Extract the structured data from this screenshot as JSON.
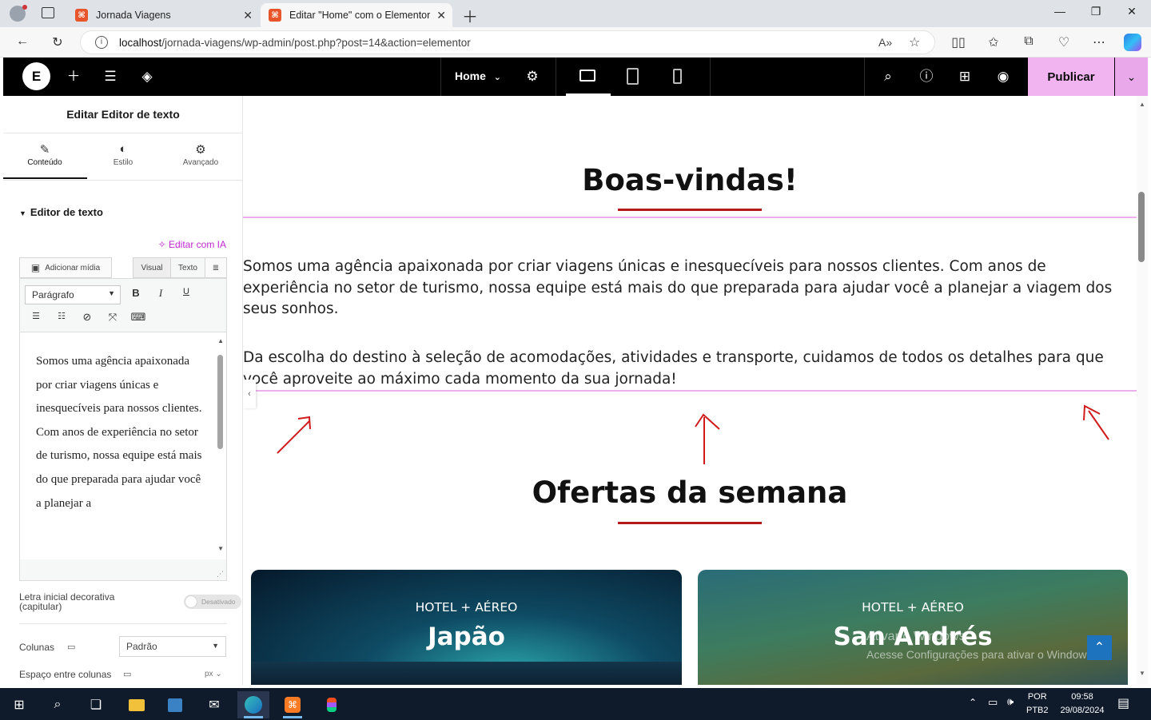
{
  "browser": {
    "tabs": [
      {
        "title": "Jornada Viagens",
        "active": false
      },
      {
        "title": "Editar \"Home\" com o Elementor",
        "active": true
      }
    ],
    "url_host": "localhost",
    "url_path": "/jornada-viagens/wp-admin/post.php?post=14&action=elementor"
  },
  "elementor_bar": {
    "page_name": "Home",
    "publish_label": "Publicar",
    "device_modes": [
      "desktop-icon",
      "tablet-icon",
      "mobile-icon"
    ]
  },
  "panel": {
    "title": "Editar Editor de texto",
    "tabs": [
      {
        "label": "Conteúdo",
        "icon": "pencil-icon"
      },
      {
        "label": "Estilo",
        "icon": "half-circle-icon"
      },
      {
        "label": "Avançado",
        "icon": "gear-icon"
      }
    ],
    "section_title": "Editor de texto",
    "ai_link": "Editar com IA",
    "add_media": "Adicionar mídia",
    "visual_tab": "Visual",
    "text_tab": "Texto",
    "paragraph_select": "Parágrafo",
    "editor_text": "Somos uma agência apaixonada por criar viagens únicas e inesquecíveis para nossos clientes. Com anos de experiência no setor de turismo, nossa equipe está mais do que preparada para ajudar você a planejar a",
    "drop_cap_label": "Letra inicial decorativa (capitular)",
    "drop_cap_value": "Desativado",
    "columns_label": "Colunas",
    "columns_value": "Padrão",
    "column_gap_label": "Espaço entre colunas",
    "column_gap_unit": "px"
  },
  "canvas": {
    "heading1": "Boas-vindas!",
    "paragraph1": "Somos uma agência apaixonada por criar viagens únicas e inesquecíveis para nossos clientes. Com anos de experiência no setor de turismo, nossa equipe está mais do que preparada para ajudar você a planejar a viagem dos seus sonhos.",
    "paragraph2": "Da escolha do destino à seleção de acomodações, atividades e transporte, cuidamos de todos os detalhes para que você aproveite ao máximo cada momento da sua jornada!",
    "heading2": "Ofertas da semana",
    "cards": [
      {
        "subtitle": "HOTEL + AÉREO",
        "title": "Japão"
      },
      {
        "subtitle": "HOTEL + AÉREO",
        "title": "San Andrés"
      }
    ],
    "watermark_line1": "Ativar o Windows",
    "watermark_line2": "Acesse Configurações para ativar o Windows."
  },
  "taskbar": {
    "lang1": "POR",
    "lang2": "PTB2",
    "time": "09:58",
    "date": "29/08/2024"
  },
  "colors": {
    "publish": "#f1b4f1",
    "accent_line": "#ecb0ec",
    "heading_underline": "#b51a1a",
    "ai_link": "#c026d3"
  }
}
